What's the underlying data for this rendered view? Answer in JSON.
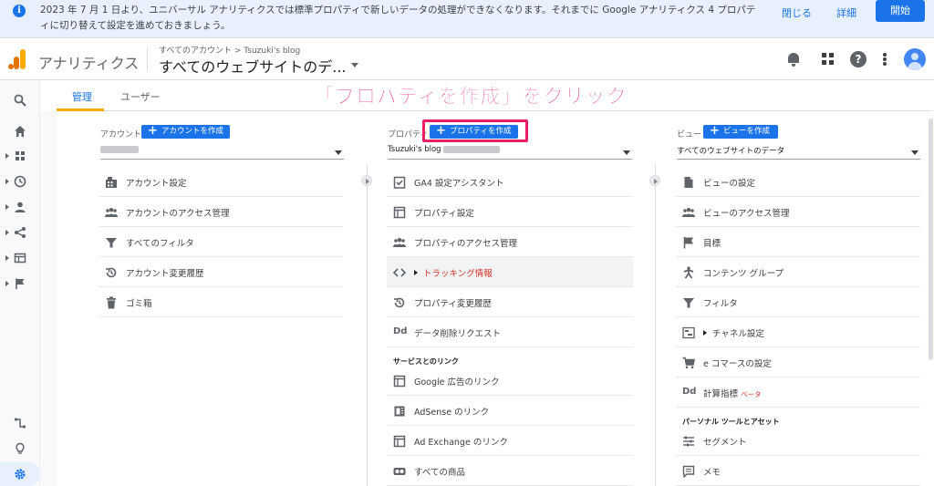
{
  "banner": {
    "message": "2023 年 7 月 1 日より、ユニバーサル アナリティクスでは標準プロパティで新しいデータの処理ができなくなります。それまでに Google アナリティクス 4 プロパティに切り替えて設定を進めておきましょう。",
    "close_label": "閉じる",
    "detail_label": "詳細",
    "start_label": "開始",
    "info_icon": "i"
  },
  "header": {
    "app_name": "アナリティクス",
    "breadcrumb": "すべてのアカウント > Tsuzuki's blog",
    "view_name": "すべてのウェブサイトのデ..."
  },
  "tabs": [
    {
      "label": "管理",
      "active": true
    },
    {
      "label": "ユーザー",
      "active": false
    }
  ],
  "annotation": "「プロパティを作成」をクリック",
  "columns": {
    "account": {
      "label": "アカウント",
      "button": "アカウントを作成",
      "items": [
        {
          "icon": "building-icon",
          "label": "アカウント設定"
        },
        {
          "icon": "people-icon",
          "label": "アカウントのアクセス管理"
        },
        {
          "icon": "filter-icon",
          "label": "すべてのフィルタ"
        },
        {
          "icon": "history-icon",
          "label": "アカウント変更履歴"
        },
        {
          "icon": "trash-icon",
          "label": "ゴミ箱"
        }
      ]
    },
    "property": {
      "label": "プロパティ",
      "button": "プロパティを作成",
      "selected": "Tsuzuki's blog",
      "items": [
        {
          "icon": "checklist-icon",
          "label": "GA4 設定アシスタント"
        },
        {
          "icon": "window-icon",
          "label": "プロパティ設定"
        },
        {
          "icon": "people-icon",
          "label": "プロパティのアクセス管理"
        },
        {
          "icon": "code-icon",
          "label": "トラッキング情報"
        },
        {
          "icon": "history-icon",
          "label": "プロパティ変更履歴"
        },
        {
          "icon": "dd-icon",
          "label": "データ削除リクエスト"
        }
      ],
      "section": "サービスとのリンク",
      "links": [
        {
          "icon": "window-icon",
          "label": "Google 広告のリンク"
        },
        {
          "icon": "adsense-icon",
          "label": "AdSense のリンク"
        },
        {
          "icon": "window-icon",
          "label": "Ad Exchange のリンク"
        },
        {
          "icon": "infinity-icon",
          "label": "すべての商品"
        }
      ]
    },
    "view": {
      "label": "ビュー",
      "button": "ビューを作成",
      "selected": "すべてのウェブサイトのデータ",
      "items": [
        {
          "icon": "document-icon",
          "label": "ビューの設定"
        },
        {
          "icon": "people-icon",
          "label": "ビューのアクセス管理"
        },
        {
          "icon": "flag-icon",
          "label": "目標"
        },
        {
          "icon": "person-walk-icon",
          "label": "コンテンツ グループ"
        },
        {
          "icon": "filter-icon",
          "label": "フィルタ"
        },
        {
          "icon": "channel-icon",
          "label": "チャネル設定"
        },
        {
          "icon": "cart-icon",
          "label": "e コマースの設定"
        },
        {
          "icon": "dd-icon",
          "label": "計算指標",
          "badge": "ベータ"
        }
      ],
      "section": "パーソナル ツールとアセット",
      "tools": [
        {
          "icon": "segment-icon",
          "label": "セグメント"
        },
        {
          "icon": "note-icon",
          "label": "メモ"
        }
      ]
    }
  },
  "colors": {
    "accent": "#1a73e8",
    "annotation": "#e91e63",
    "tab_underline": "#f9ab00",
    "link_red": "#d93025"
  }
}
